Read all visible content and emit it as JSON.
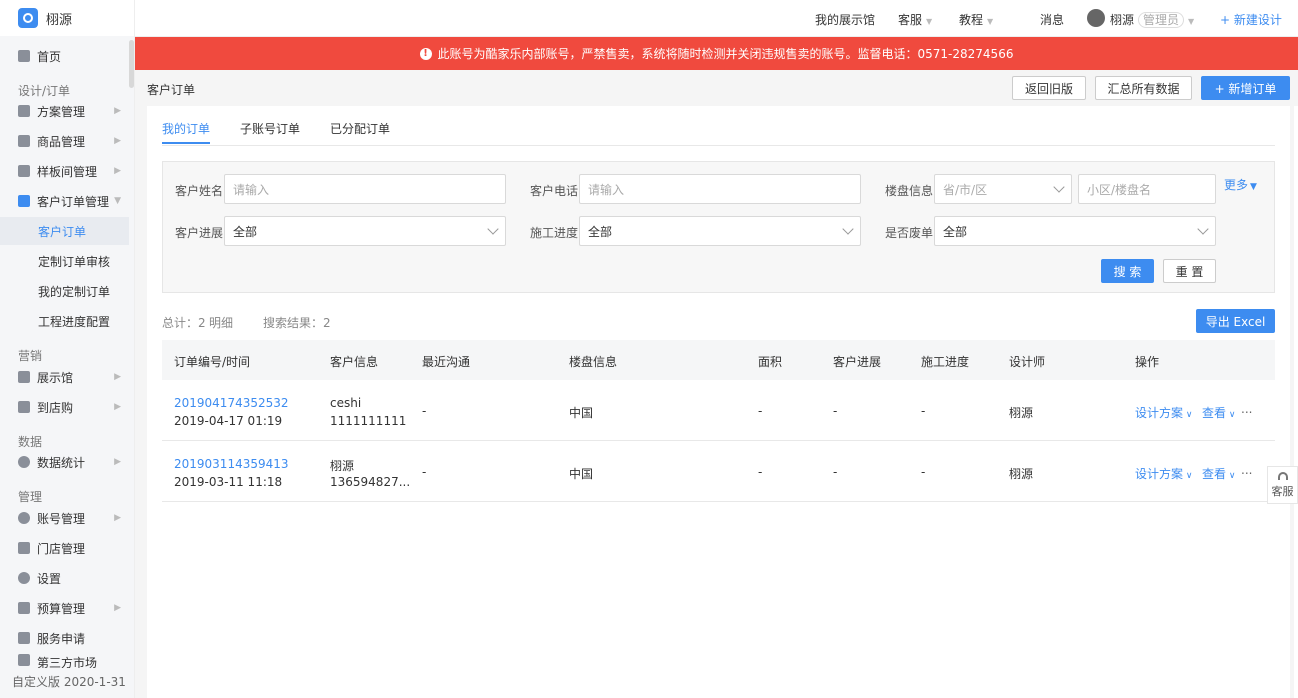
{
  "app": {
    "logo_name": "栩源"
  },
  "topbar": {
    "showroom": "我的展示馆",
    "service": "客服",
    "tutorial": "教程",
    "messages": "消息",
    "user_name": "栩源",
    "user_role": "管理员",
    "new_design": "+ 新建设计"
  },
  "alert": {
    "text": "此账号为酷家乐内部账号，严禁售卖，系统将随时检测并关闭违规售卖的账号。监督电话：0571-28274566"
  },
  "sidebar": {
    "home": "首页",
    "group_design": "设计/订单",
    "scheme": "方案管理",
    "goods": "商品管理",
    "sample": "样板间管理",
    "order_mgmt": "客户订单管理",
    "sub_customer_order": "客户订单",
    "sub_custom_review": "定制订单审核",
    "sub_my_custom": "我的定制订单",
    "sub_progress": "工程进度配置",
    "group_marketing": "营销",
    "exhibit": "展示馆",
    "store_visit": "到店购",
    "group_data": "数据",
    "stats": "数据统计",
    "group_manage": "管理",
    "account": "账号管理",
    "stores": "门店管理",
    "settings": "设置",
    "budget": "预算管理",
    "service_apply": "服务申请",
    "third_market": "第三方市场",
    "version": "自定义版 2020-1-31"
  },
  "page": {
    "title": "客户订单",
    "btn_old": "返回旧版",
    "btn_summary": "汇总所有数据",
    "btn_new_order": "+ 新增订单"
  },
  "tabs": [
    "我的订单",
    "子账号订单",
    "已分配订单"
  ],
  "filter": {
    "name_label": "客户姓名",
    "name_placeholder": "请输入",
    "phone_label": "客户电话",
    "phone_placeholder": "请输入",
    "building_label": "楼盘信息",
    "region_placeholder": "省/市/区",
    "community_placeholder": "小区/楼盘名",
    "more": "更多",
    "progress_label": "客户进展",
    "progress_value": "全部",
    "construction_label": "施工进度",
    "construction_value": "全部",
    "void_label": "是否废单",
    "void_value": "全部",
    "search_btn": "搜 索",
    "reset_btn": "重 置"
  },
  "summary": {
    "total": "总计：2",
    "detail": "明细",
    "results": "搜索结果：2",
    "export": "导出 Excel"
  },
  "table": {
    "headers": [
      "订单编号/时间",
      "客户信息",
      "最近沟通",
      "楼盘信息",
      "面积",
      "客户进展",
      "施工进度",
      "设计师",
      "操作"
    ],
    "rows": [
      {
        "order_no": "201904174352532",
        "time": "2019-04-17 01:19",
        "cust_name": "ceshi",
        "cust_phone": "1111111111",
        "recent": "-",
        "building": "中国",
        "area": "-",
        "progress": "-",
        "construction": "-",
        "designer": "栩源",
        "op_design": "设计方案",
        "op_view": "查看",
        "op_more": "..."
      },
      {
        "order_no": "201903114359413",
        "time": "2019-03-11 11:18",
        "cust_name": "栩源",
        "cust_phone": "136594827...",
        "recent": "-",
        "building": "中国",
        "area": "-",
        "progress": "-",
        "construction": "-",
        "designer": "栩源",
        "op_design": "设计方案",
        "op_view": "查看",
        "op_more": "..."
      }
    ]
  },
  "float": {
    "kefu": "客服"
  }
}
